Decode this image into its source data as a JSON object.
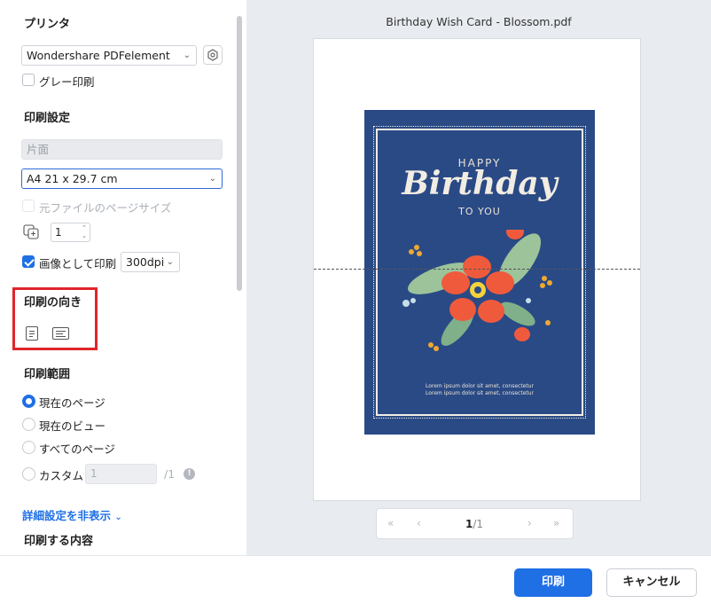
{
  "printer": {
    "heading": "プリンタ",
    "selected": "Wondershare PDFelement",
    "grayscale_label": "グレー印刷"
  },
  "print_settings": {
    "heading": "印刷設定",
    "duplex": "片面",
    "paper_size": "A4 21 x 29.7 cm",
    "original_size_label": "元ファイルのページサイズ",
    "copies": "1",
    "print_as_image_label": "画像として印刷",
    "dpi": "300dpi"
  },
  "orientation": {
    "heading": "印刷の向き"
  },
  "print_range": {
    "heading": "印刷範囲",
    "options": [
      "現在のページ",
      "現在のビュー",
      "すべてのページ",
      "カスタム"
    ],
    "selected": "現在のページ",
    "custom_value": "1",
    "custom_total": "/1"
  },
  "advanced_link": "詳細設定を非表示",
  "next_section_heading": "印刷する内容",
  "preview": {
    "file_name": "Birthday Wish Card - Blossom.pdf",
    "card": {
      "line1": "HAPPY",
      "line2": "Birthday",
      "line3": "TO YOU",
      "footer1": "Lorem ipsum dolor sit amet, consectetur",
      "footer2": "Lorem ipsum dolor sit amet, consectetur"
    },
    "current_page": "1",
    "total_pages": "/1"
  },
  "buttons": {
    "print": "印刷",
    "cancel": "キャンセル"
  },
  "colors": {
    "accent": "#1f6fe5",
    "highlight_box": "#e0252b",
    "card_bg": "#2a4a86"
  }
}
